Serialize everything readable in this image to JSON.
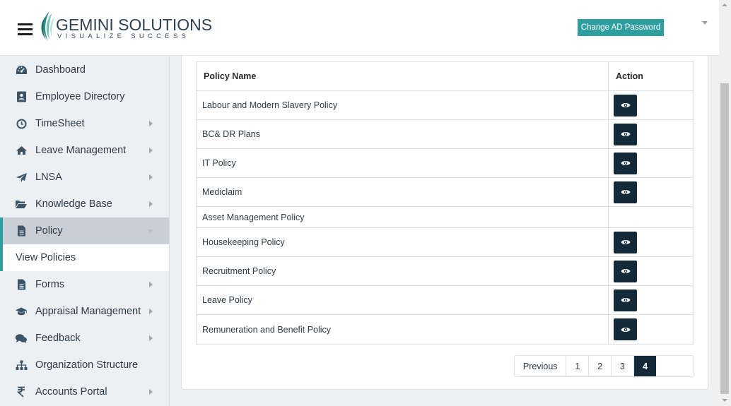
{
  "header": {
    "brand_name": "GEMINI SOLUTIONS",
    "brand_tagline": "VISUALIZE SUCCESS",
    "change_password_label": "Change AD Password"
  },
  "sidebar": {
    "items": [
      {
        "label": "Dashboard",
        "icon": "dashboard-icon",
        "has_submenu": false
      },
      {
        "label": "Employee Directory",
        "icon": "contact-card-icon",
        "has_submenu": false
      },
      {
        "label": "TimeSheet",
        "icon": "clock-icon",
        "has_submenu": true
      },
      {
        "label": "Leave Management",
        "icon": "home-icon",
        "has_submenu": true
      },
      {
        "label": "LNSA",
        "icon": "paper-plane-icon",
        "has_submenu": true
      },
      {
        "label": "Knowledge Base",
        "icon": "folder-open-icon",
        "has_submenu": true
      },
      {
        "label": "Policy",
        "icon": "document-icon",
        "has_submenu": true,
        "active": true
      },
      {
        "label": "Forms",
        "icon": "document-icon",
        "has_submenu": true
      },
      {
        "label": "Appraisal Management",
        "icon": "graduation-cap-icon",
        "has_submenu": true
      },
      {
        "label": "Feedback",
        "icon": "chat-bubbles-icon",
        "has_submenu": true
      },
      {
        "label": "Organization Structure",
        "icon": "org-chart-icon",
        "has_submenu": false
      },
      {
        "label": "Accounts Portal",
        "icon": "rupee-icon",
        "has_submenu": true
      }
    ],
    "sub_item": "View Policies"
  },
  "table": {
    "columns": [
      "Policy Name",
      "Action"
    ],
    "rows": [
      {
        "name": "Labour and Modern Slavery Policy",
        "has_view": true
      },
      {
        "name": "BC& DR Plans",
        "has_view": true
      },
      {
        "name": "IT Policy",
        "has_view": true
      },
      {
        "name": "Mediclaim",
        "has_view": true
      },
      {
        "name": "Asset Management Policy",
        "has_view": false
      },
      {
        "name": "Housekeeping Policy",
        "has_view": true
      },
      {
        "name": "Recruitment Policy",
        "has_view": true
      },
      {
        "name": "Leave Policy",
        "has_view": true
      },
      {
        "name": "Remuneration and Benefit Policy",
        "has_view": true
      }
    ]
  },
  "pagination": {
    "previous_label": "Previous",
    "pages": [
      "1",
      "2",
      "3",
      "4"
    ],
    "current_page": "4",
    "next_label": ""
  },
  "colors": {
    "accent": "#2f9ea0",
    "dark_button": "#142a38",
    "sidebar_bg": "#edf0f2",
    "active_item_bg": "#c9d0d5"
  }
}
